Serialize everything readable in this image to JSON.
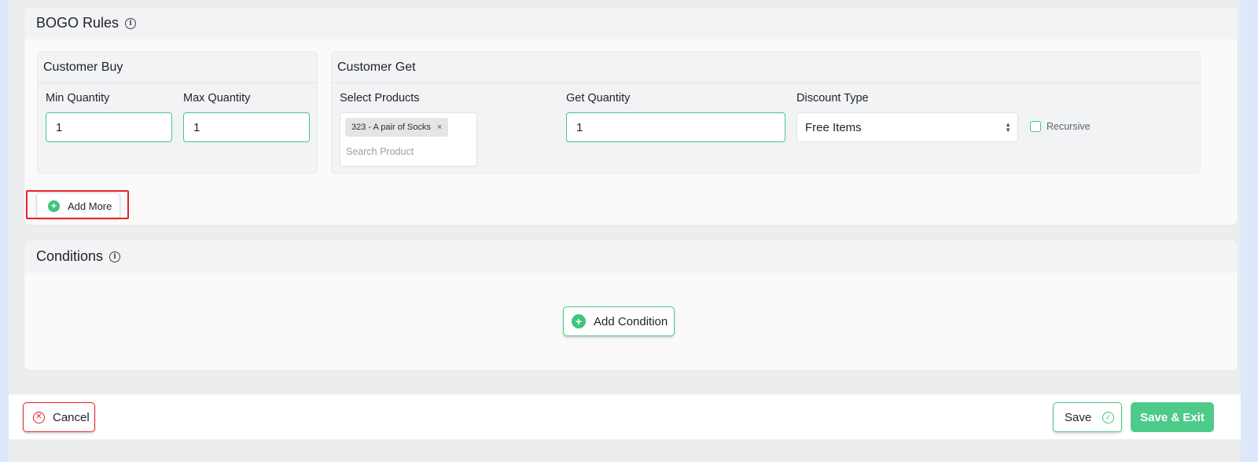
{
  "bogo": {
    "title": "BOGO Rules",
    "customer_buy": {
      "title": "Customer Buy",
      "min_label": "Min Quantity",
      "min_value": "1",
      "max_label": "Max Quantity",
      "max_value": "1"
    },
    "customer_get": {
      "title": "Customer Get",
      "products_label": "Select Products",
      "product_chip": "323 - A pair of Socks",
      "chip_remove": "×",
      "search_placeholder": "Search Product",
      "qty_label": "Get Quantity",
      "qty_value": "1",
      "discount_label": "Discount Type",
      "discount_value": "Free Items",
      "recursive_label": "Recursive"
    },
    "add_more_label": "Add More"
  },
  "conditions": {
    "title": "Conditions",
    "add_condition_label": "Add Condition"
  },
  "footer": {
    "cancel_label": "Cancel",
    "save_label": "Save",
    "save_exit_label": "Save & Exit"
  },
  "colors": {
    "accent_green": "#48c784",
    "danger_red": "#e3222a",
    "background": "#dce8fb"
  }
}
